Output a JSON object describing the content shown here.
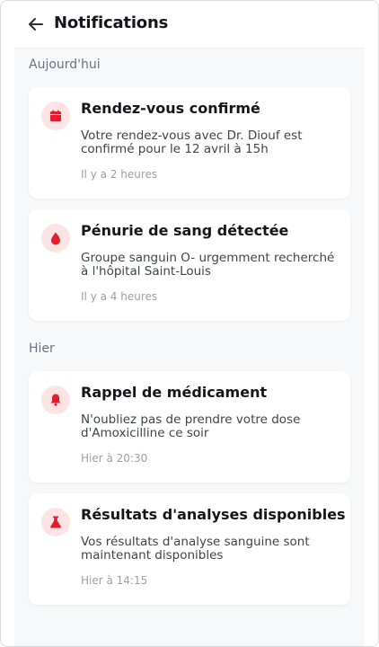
{
  "header": {
    "title": "Notifications",
    "back_icon": "arrow-left-icon"
  },
  "accent_color": "#e11d2e",
  "badge_color": "#fde4e4",
  "sections": [
    {
      "title": "Aujourd'hui",
      "notifications": [
        {
          "icon": "calendar-icon",
          "title": "Rendez-vous confirmé",
          "message": "Votre rendez-vous avec Dr. Diouf est confirmé pour le 12 avril à 15h",
          "time": "Il y a 2 heures"
        },
        {
          "icon": "blood-drop-icon",
          "title": "Pénurie de sang détectée",
          "message": "Groupe sanguin O- urgemment recherché à l'hôpital Saint-Louis",
          "time": "Il y a 4 heures"
        }
      ]
    },
    {
      "title": "Hier",
      "notifications": [
        {
          "icon": "bell-icon",
          "title": "Rappel de médicament",
          "message": "N'oubliez pas de prendre votre dose d'Amoxicilline ce soir",
          "time": "Hier à 20:30"
        },
        {
          "icon": "flask-icon",
          "title": "Résultats d'analyses disponibles",
          "message": "Vos résultats d'analyse sanguine sont maintenant disponibles",
          "time": "Hier à 14:15"
        }
      ]
    }
  ]
}
